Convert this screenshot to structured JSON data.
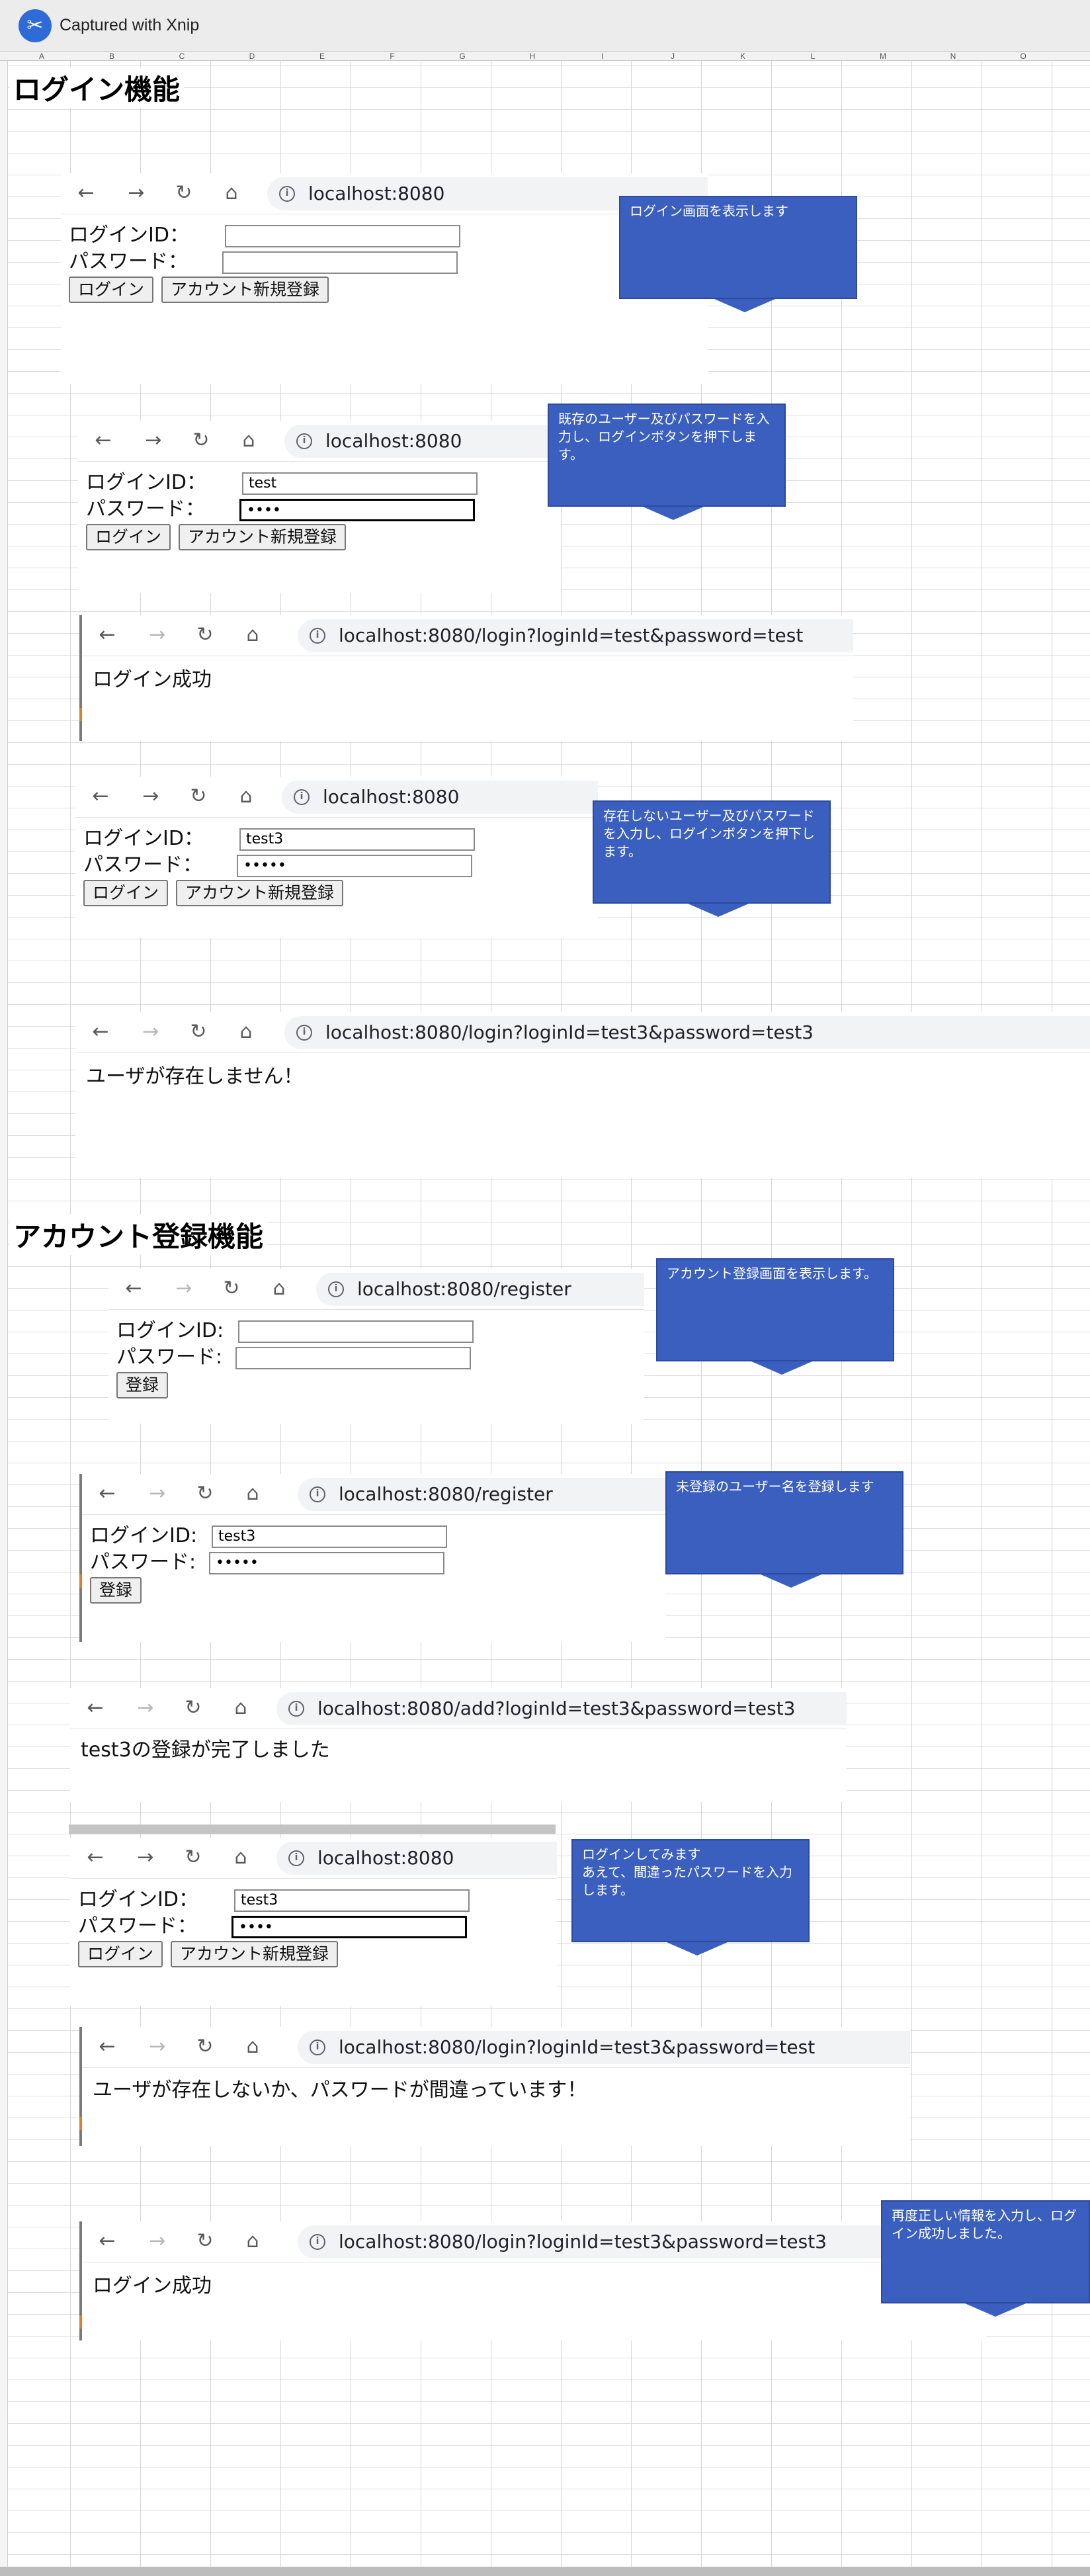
{
  "app": {
    "title": "Captured with Xnip",
    "logo_icon": "scissors-icon"
  },
  "columns": [
    "A",
    "B",
    "C",
    "D",
    "E",
    "F",
    "G",
    "H",
    "I",
    "J",
    "K",
    "L",
    "M",
    "N",
    "O"
  ],
  "sections": {
    "login": "ログイン機能",
    "register": "アカウント登録機能"
  },
  "common": {
    "back": "←",
    "forward": "→",
    "reload": "↻",
    "home": "⌂",
    "info": "i",
    "login_id_label": "ログインID：",
    "password_label": "パスワード：",
    "reg_login_id_label": "ログインID:",
    "reg_password_label": "パスワード:",
    "login_button": "ログイン",
    "new_account_button": "アカウント新規登録",
    "register_button": "登録"
  },
  "shots": {
    "s1": {
      "url": "localhost:8080",
      "login_id": "",
      "password": ""
    },
    "s2": {
      "url": "localhost:8080",
      "login_id": "test",
      "password": "••••"
    },
    "s3": {
      "url": "localhost:8080/login?loginId=test&password=test",
      "message": "ログイン成功"
    },
    "s4": {
      "url": "localhost:8080",
      "login_id": "test3",
      "password": "•••••"
    },
    "s5": {
      "url": "localhost:8080/login?loginId=test3&password=test3",
      "message": "ユーザが存在しません！"
    },
    "s6": {
      "url": "localhost:8080/register",
      "login_id": "",
      "password": ""
    },
    "s7": {
      "url": "localhost:8080/register",
      "login_id": "test3",
      "password": "•••••"
    },
    "s8": {
      "url": "localhost:8080/add?loginId=test3&password=test3",
      "message": "test3の登録が完了しました"
    },
    "s9": {
      "url": "localhost:8080",
      "login_id": "test3",
      "password": "••••"
    },
    "s10": {
      "url": "localhost:8080/login?loginId=test3&password=test",
      "message": "ユーザが存在しないか、パスワードが間違っています！"
    },
    "s11": {
      "url": "localhost:8080/login?loginId=test3&password=test3",
      "message": "ログイン成功"
    }
  },
  "callouts": {
    "c1": "ログイン画面を表示します",
    "c2": "既存のユーザー及びパスワードを入力し、ログインボタンを押下します。",
    "c3": "存在しないユーザー及びパスワードを入力し、ログインボタンを押下します。",
    "c4": "アカウント登録画面を表示します。",
    "c5": "未登録のユーザー名を登録します",
    "c6": "ログインしてみます\nあえて、間違ったパスワードを入力します。",
    "c7": "再度正しい情報を入力し、ログイン成功しました。"
  },
  "colors": {
    "callout": "#3a5fbf",
    "address_bar": "#f1f3f4"
  }
}
